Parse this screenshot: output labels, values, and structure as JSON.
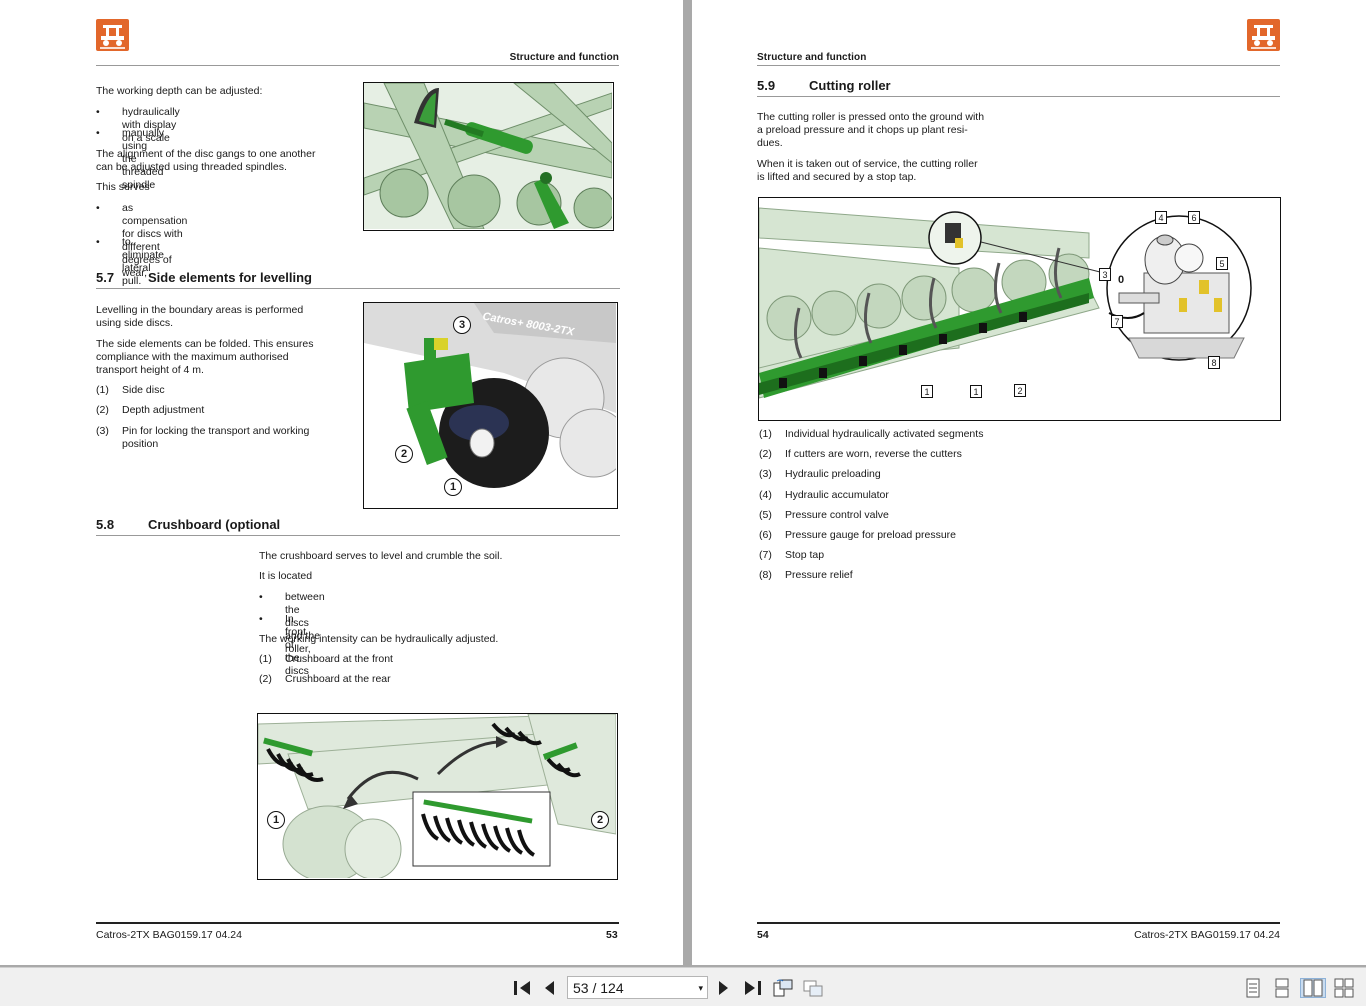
{
  "viewer": {
    "page_current": "53",
    "page_sep": "/",
    "page_total": "124",
    "dropdown_glyph": "▾"
  },
  "left_page": {
    "running_head": "Structure and function",
    "intro_lines": [
      "The working depth can be adjusted:"
    ],
    "depth_bullets": [
      "hydraulically with display on a scale",
      "manually using the threaded spindle"
    ],
    "alignment_text": [
      "The alignment of the disc gangs to one another",
      "can be adjusted using threaded spindles."
    ],
    "serves_text": "This serves",
    "serves_bullets": [
      [
        "as compensation for discs with different",
        "degrees of wear,"
      ],
      [
        "to eliminate lateral pull."
      ]
    ],
    "section_57": {
      "number": "5.7",
      "title": "Side elements for levelling"
    },
    "s57_p1": [
      "Levelling in the boundary areas is performed",
      "using side discs."
    ],
    "s57_p2": [
      "The side elements can be folded. This ensures",
      "compliance with the maximum authorised",
      "transport height of 4 m."
    ],
    "s57_legend": [
      {
        "n": "(1)",
        "lines": [
          "Side disc"
        ]
      },
      {
        "n": "(2)",
        "lines": [
          "Depth adjustment"
        ]
      },
      {
        "n": "(3)",
        "lines": [
          "Pin for locking the transport and working",
          "position"
        ]
      }
    ],
    "fig2_callouts": [
      "3",
      "2",
      "1"
    ],
    "fig2_machine_text": "Catros+ 8003-2TX",
    "section_58": {
      "number": "5.8",
      "title": "Crushboard (optional"
    },
    "s58_p1": "The crushboard serves to level and crumble the soil.",
    "s58_p2": "It is located",
    "s58_bullets": [
      "between the discs and the roller,",
      "In front of the discs"
    ],
    "s58_p3": "The working intensity can be hydraulically adjusted.",
    "s58_legend": [
      {
        "n": "(1)",
        "lines": [
          "Crushboard at the front"
        ]
      },
      {
        "n": "(2)",
        "lines": [
          "Crushboard at the rear"
        ]
      }
    ],
    "fig3_callouts": [
      "1",
      "2"
    ],
    "footer_doc": "Catros-2TX  BAG0159.17  04.24",
    "footer_page": "53"
  },
  "right_page": {
    "running_head": "Structure and function",
    "section_59": {
      "number": "5.9",
      "title": "Cutting roller"
    },
    "p1": [
      "The cutting roller is pressed onto the ground with",
      "a preload pressure and it chops up plant resi-",
      "dues."
    ],
    "p2": [
      "When it is taken out of service, the cutting roller",
      "is lifted and secured by a stop tap."
    ],
    "fig_callouts": {
      "c1a": "1",
      "c1b": "1",
      "c2": "2",
      "c3": "3",
      "c4": "4",
      "c5": "5",
      "c6": "6",
      "c7": "7",
      "c8": "8",
      "valve_label": "0"
    },
    "legend": [
      {
        "n": "(1)",
        "l": "Individual hydraulically activated segments"
      },
      {
        "n": "(2)",
        "l": "If cutters are worn, reverse the cutters"
      },
      {
        "n": "(3)",
        "l": "Hydraulic preloading"
      },
      {
        "n": "(4)",
        "l": "Hydraulic accumulator"
      },
      {
        "n": "(5)",
        "l": "Pressure control valve"
      },
      {
        "n": "(6)",
        "l": "Pressure gauge for preload pressure"
      },
      {
        "n": "(7)",
        "l": "Stop tap"
      },
      {
        "n": "(8)",
        "l": "Pressure relief"
      }
    ],
    "footer_page": "54",
    "footer_doc": "Catros-2TX  BAG0159.17  04.24"
  },
  "colors": {
    "machine_green": "#2f9a2f",
    "frame_green": "#c9dcc6",
    "logo_orange": "#e2672b"
  },
  "icons": [
    "first-page-icon",
    "prev-page-icon",
    "next-page-icon",
    "last-page-icon",
    "rotate-icon",
    "fit-page-icon",
    "single-page-icon",
    "scroll-icon",
    "two-page-icon",
    "two-page-scroll-icon"
  ]
}
